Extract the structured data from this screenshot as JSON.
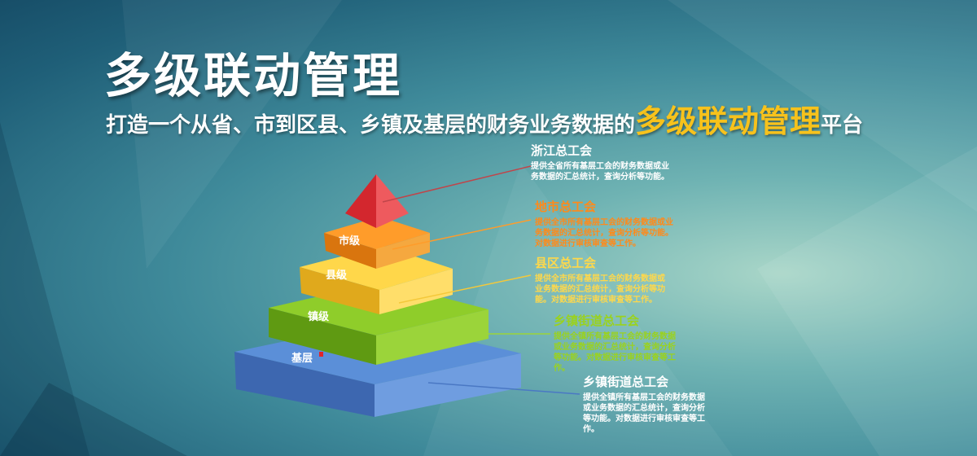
{
  "title": "多级联动管理",
  "subtitle": {
    "prefix": "打造一个从省、市到区县、乡镇及基层的财务业务数据的",
    "highlight": "多级联动管理",
    "suffix": "平台"
  },
  "pyramid": {
    "top_label": "",
    "tier_labels": [
      "市级",
      "县级",
      "镇级",
      "基层"
    ]
  },
  "notes": [
    {
      "title": "浙江总工会",
      "desc": "提供全省所有基层工会的财务数据或业务数据的汇总统计，查询分析等功能。",
      "title_color": "#ffffff",
      "desc_color": "#ffffff"
    },
    {
      "title": "地市总工会",
      "desc": "提供全市所有基层工会的财务数据或业务数据的汇总统计，查询分析等功能。对数据进行审核审查等工作。",
      "title_color": "#ff8a1a",
      "desc_color": "#ff8a1a"
    },
    {
      "title": "县区总工会",
      "desc": "提供全市所有基层工会的财务数据或业务数据的汇总统计，查询分析等功能。对数据进行审核审查等工作。",
      "title_color": "#ffd84a",
      "desc_color": "#ffd84a"
    },
    {
      "title": "乡镇街道总工会",
      "desc": "提供全镇所有基层工会的财务数据或业务数据的汇总统计，查询分析等功能。对数据进行审核审查等工作。",
      "title_color": "#9ad21e",
      "desc_color": "#9ad21e"
    },
    {
      "title": "乡镇街道总工会",
      "desc": "提供全镇所有基层工会的财务数据或业务数据的汇总统计，查询分析等功能。对数据进行审核审查等工作。",
      "title_color": "#ffffff",
      "desc_color": "#ffffff"
    }
  ],
  "colors": {
    "accent": "#f7c21c",
    "apex": "#d8343a",
    "tier1": "#f08a12",
    "tier2": "#f4c83a",
    "tier3": "#7cb81c",
    "tier4": "#4a78c4"
  }
}
